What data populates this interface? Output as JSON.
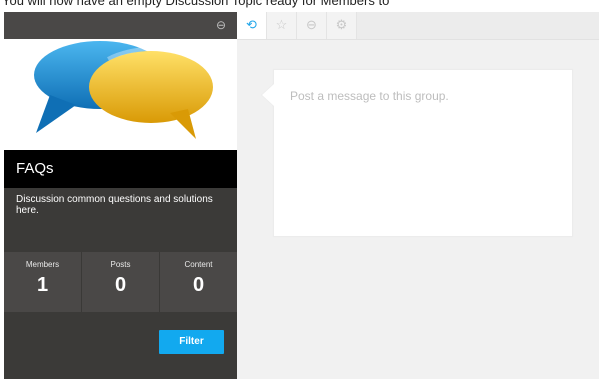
{
  "top_caption": "You will now have an empty Discussion Topic ready for Members to",
  "sidebar": {
    "group_title": "FAQs",
    "group_description": "Discussion common questions and solutions here.",
    "stats": [
      {
        "label": "Members",
        "value": "1"
      },
      {
        "label": "Posts",
        "value": "0"
      },
      {
        "label": "Content",
        "value": "0"
      }
    ],
    "filter_label": "Filter"
  },
  "tabs": [
    {
      "name": "activity",
      "icon": "history-icon",
      "glyph": "⟲",
      "active": true
    },
    {
      "name": "favorites",
      "icon": "star-icon",
      "glyph": "☆",
      "active": false
    },
    {
      "name": "links",
      "icon": "link-icon",
      "glyph": "⊖",
      "active": false
    },
    {
      "name": "settings",
      "icon": "gear-icon",
      "glyph": "⚙",
      "active": false
    }
  ],
  "post": {
    "placeholder": "Post a message to this group."
  },
  "colors": {
    "accent": "#12a9ef",
    "sidebar_bg": "#3b3a38",
    "title_bar": "#000000",
    "bubble_blue": "#1b8fd4",
    "bubble_yellow": "#f2c21a"
  }
}
